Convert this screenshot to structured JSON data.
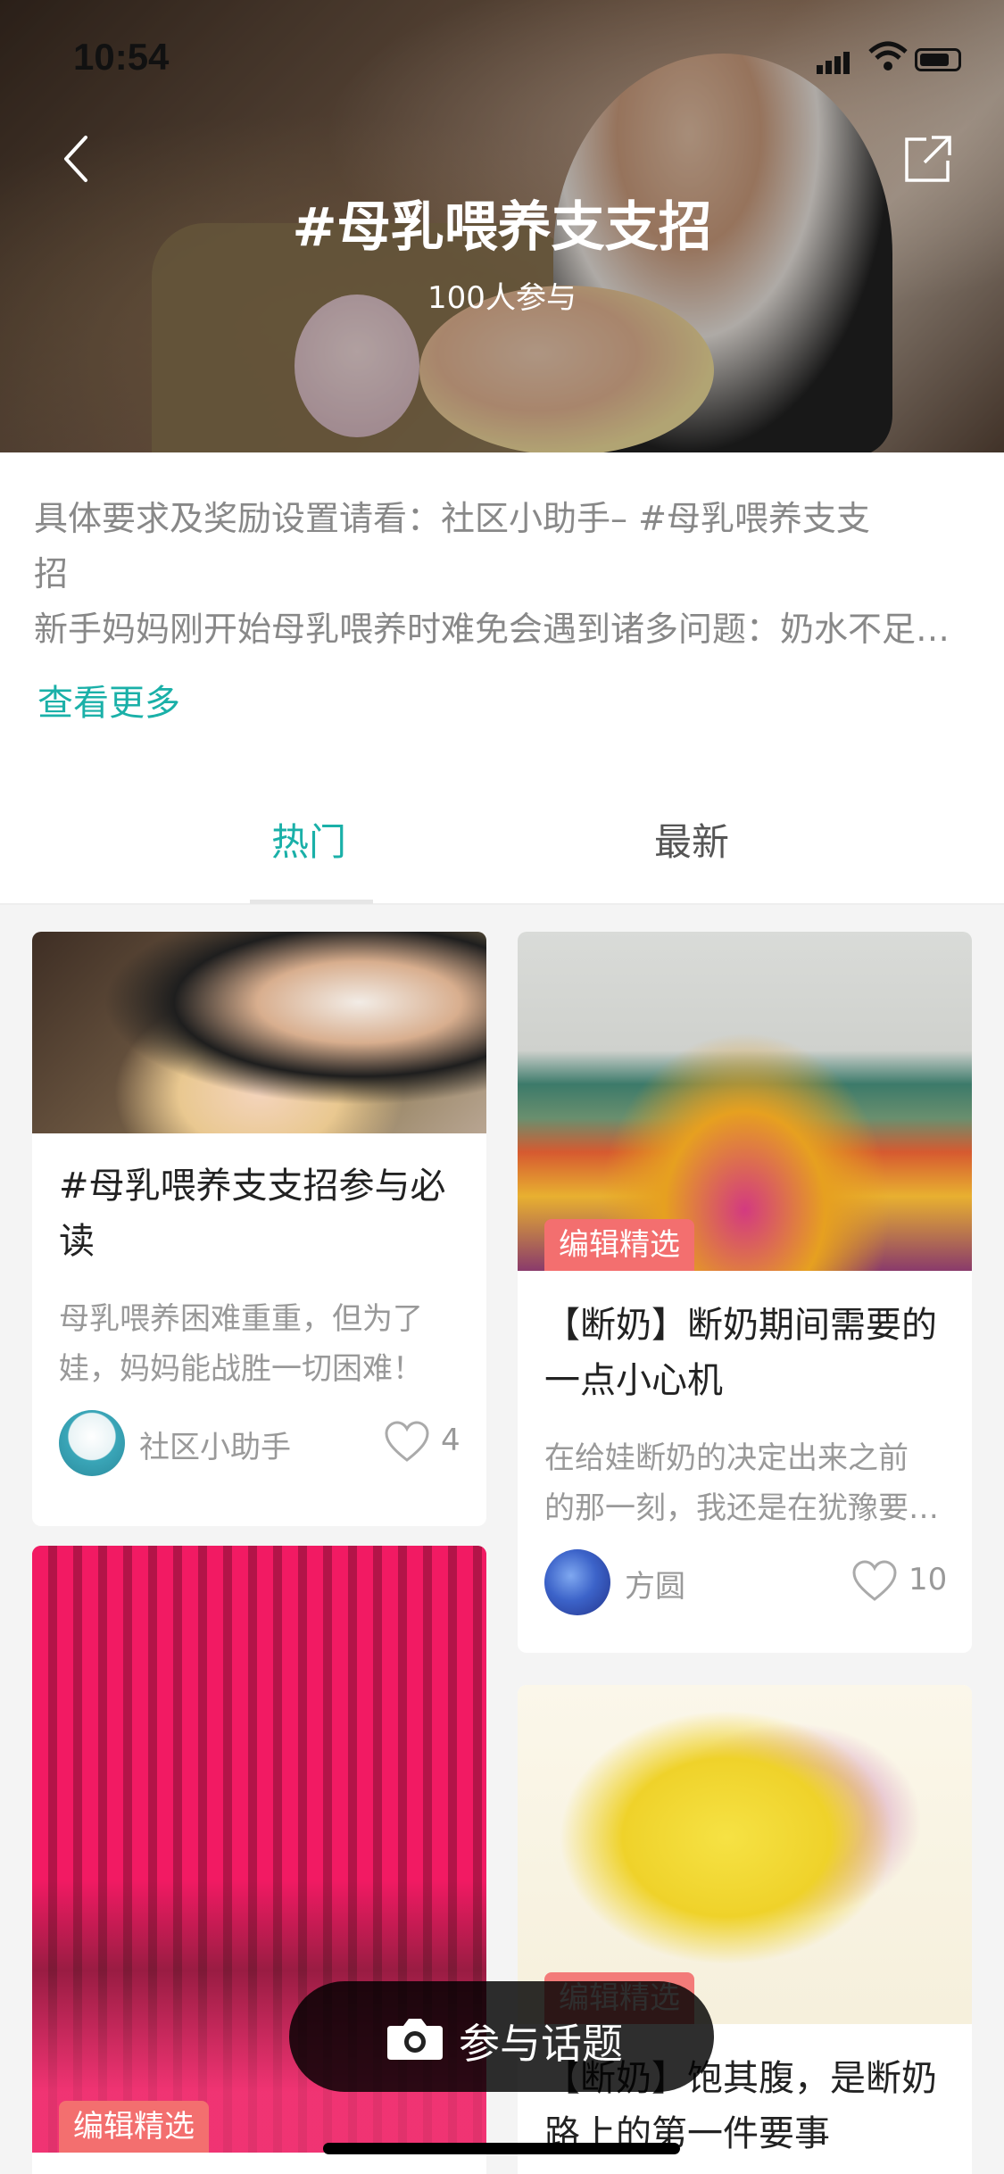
{
  "status_bar": {
    "time": "10:54"
  },
  "header": {
    "title": "#母乳喂养支支招",
    "participants": "100人参与"
  },
  "description": {
    "line1": "具体要求及奖励设置请看：社区小助手– #母乳喂养支支",
    "line2": "招",
    "line3": "新手妈妈刚开始母乳喂养时难免会遇到诸多问题：奶水不足、宝宝不会吸…",
    "more_label": "查看更多"
  },
  "tabs": [
    {
      "label": "热门",
      "active": true
    },
    {
      "label": "最新",
      "active": false
    }
  ],
  "cards": [
    {
      "title": "#母乳喂养支支招参与必读",
      "summary_line1": "母乳喂养困难重重，但为了",
      "summary_line2": "娃，妈妈能战胜一切困难！",
      "author": "社区小助手",
      "likes": "4",
      "image": "woman-breastfeeding-photo"
    },
    {
      "badge": "编辑精选",
      "title": "【断奶】断奶期间需要的一点小心机",
      "summary_line1": "在给娃断奶的决定出来之前",
      "summary_line2": "的那一刻，我还是在犹豫要不要给娃断奶…",
      "author": "方圆",
      "likes": "10",
      "image": "dragon-flower-display-photo"
    },
    {
      "badge": "编辑精选",
      "image": "red-lanterns-photo"
    },
    {
      "badge": "编辑精选",
      "title": "【断奶】饱其腹，是断奶路上的第一件要事",
      "image": "moon-mother-child-drawing"
    }
  ],
  "join_button": {
    "label": "参与话题",
    "icon": "camera-icon"
  },
  "colors": {
    "accent": "#1ab0a8",
    "badge": "#f36f6f",
    "feed_bg": "#f4f4f4"
  }
}
